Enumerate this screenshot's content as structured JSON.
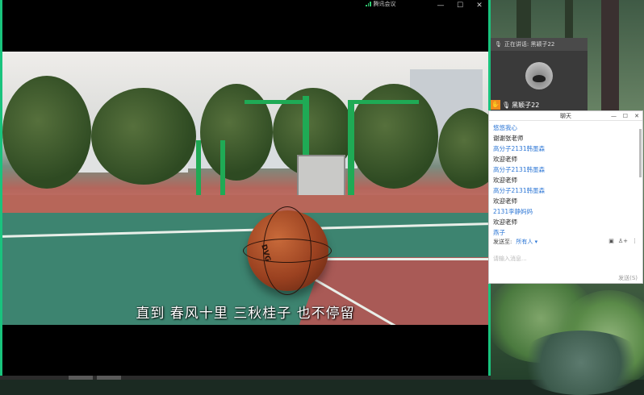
{
  "window": {
    "title": "腾讯会议",
    "accent_color": "#19c37d",
    "controls": {
      "minimize": "—",
      "maximize": "☐",
      "close": "✕"
    }
  },
  "video": {
    "subtitle": "直到 春风十里 三秋桂子 也不停留",
    "ball_text": "DVG"
  },
  "speaker_panel": {
    "status": "正在讲话: 黑颖子22",
    "participant_name": "黑颖子22",
    "icons": [
      "mic-icon",
      "hand-icon"
    ]
  },
  "chat": {
    "title": "聊天",
    "controls": {
      "minimize": "—",
      "maximize": "☐",
      "close": "✕"
    },
    "messages": [
      {
        "kind": "name",
        "text": "悠悠我心"
      },
      {
        "kind": "text",
        "text": "谢谢张老师"
      },
      {
        "kind": "name",
        "text": "高分子2131韩墨森"
      },
      {
        "kind": "text",
        "text": "欢迎老师"
      },
      {
        "kind": "name",
        "text": "高分子2131韩墨森"
      },
      {
        "kind": "text",
        "text": "欢迎老师"
      },
      {
        "kind": "name",
        "text": "高分子2131韩墨森"
      },
      {
        "kind": "text",
        "text": "欢迎老师"
      },
      {
        "kind": "name",
        "text": "2131李静妈妈"
      },
      {
        "kind": "text",
        "text": "欢迎老师"
      },
      {
        "kind": "name",
        "text": "燕子"
      }
    ],
    "send_to_label": "发送至:",
    "send_to_target": "所有人 ▾",
    "input_placeholder": "请输入消息...",
    "send_button": "发送(S)",
    "name_color": "#2f78d6"
  }
}
